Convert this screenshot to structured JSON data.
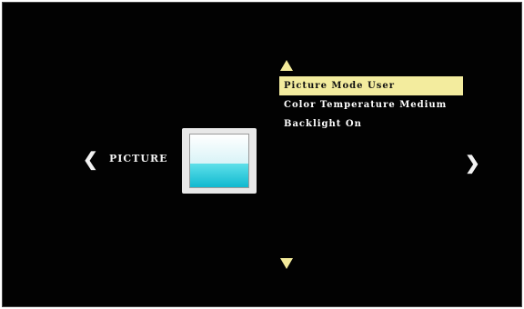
{
  "section": {
    "label": "PICTURE",
    "prev_glyph": "❮",
    "next_glyph": "❯",
    "icon": "picture-settings-icon"
  },
  "menu": {
    "items": [
      {
        "label": "Picture Mode User",
        "selected": true
      },
      {
        "label": "Color Temperature Medium",
        "selected": false
      },
      {
        "label": "Backlight On",
        "selected": false
      }
    ]
  },
  "colors": {
    "background": "#020202",
    "highlight": "#f3ec9e",
    "arrow": "#f3ea9a",
    "text": "#ffffff",
    "icon_water": "#10b9d0"
  }
}
